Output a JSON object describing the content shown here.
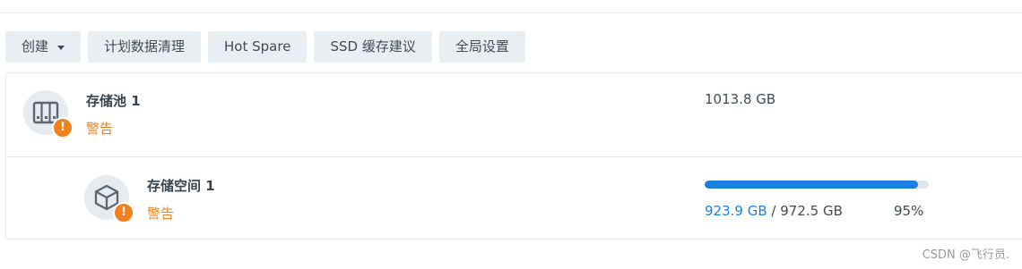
{
  "toolbar": {
    "create": "创建",
    "scrub": "计划数据清理",
    "hot_spare": "Hot Spare",
    "ssd_cache": "SSD 缓存建议",
    "global": "全局设置"
  },
  "pool": {
    "name": "存储池 1",
    "status": "警告",
    "capacity": "1013.8 GB",
    "badge": "!",
    "icon": "storage-pool-icon"
  },
  "volume": {
    "name": "存储空间 1",
    "status": "警告",
    "used": "923.9 GB",
    "sep": "/",
    "total": "972.5 GB",
    "percent_text": "95%",
    "percent": 95,
    "badge": "!",
    "icon": "cube-icon"
  },
  "colors": {
    "accent": "#1a7fe0",
    "warning": "#f0821e"
  },
  "watermark": "CSDN @飞行员."
}
